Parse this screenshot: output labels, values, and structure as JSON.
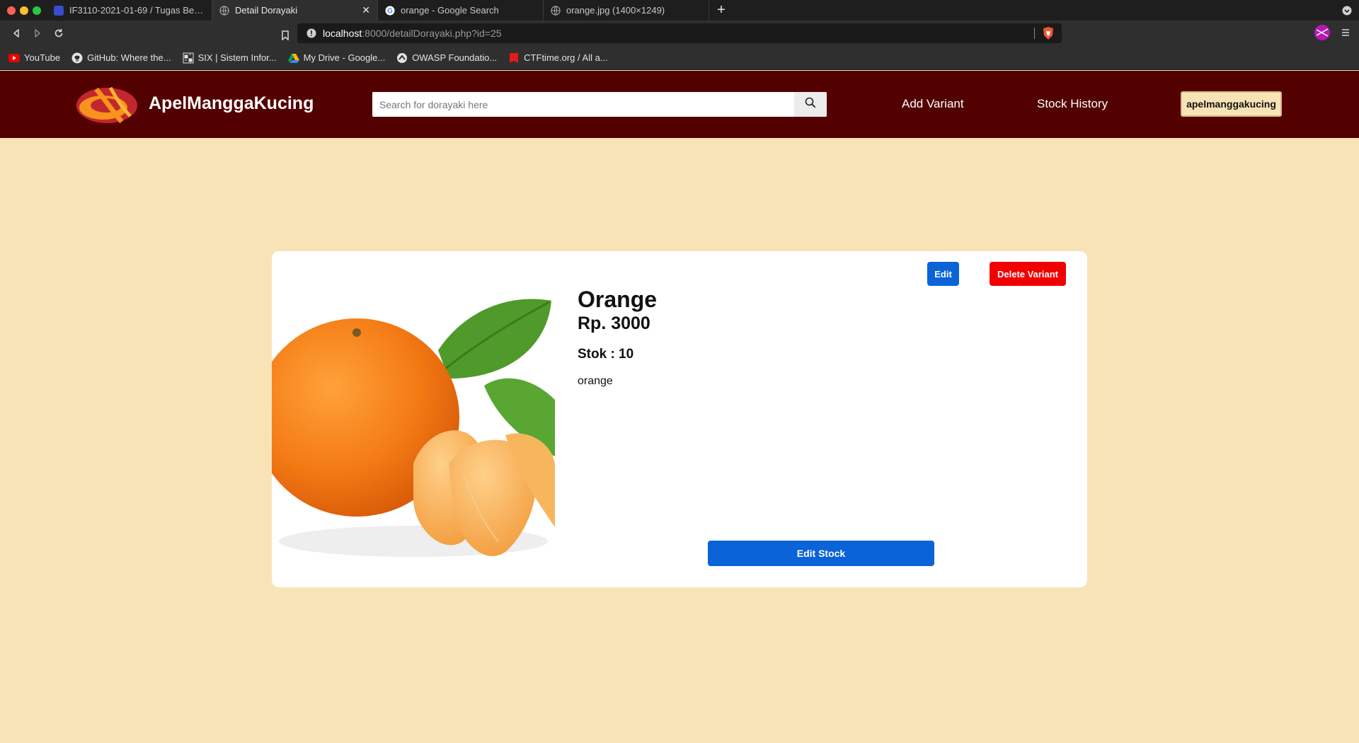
{
  "browser": {
    "tabs": [
      {
        "title": "IF3110-2021-01-69 / Tugas Besar 1",
        "icon": "gitlab-icon",
        "active": false
      },
      {
        "title": "Detail Dorayaki",
        "icon": "globe-icon",
        "active": true
      },
      {
        "title": "orange - Google Search",
        "icon": "google-icon",
        "active": false
      },
      {
        "title": "orange.jpg (1400×1249)",
        "icon": "globe-icon",
        "active": false
      }
    ],
    "url_host": "localhost",
    "url_rest": ":8000/detailDorayaki.php?id=25",
    "bookmarks": [
      {
        "label": "YouTube",
        "icon": "youtube-icon"
      },
      {
        "label": "GitHub: Where the...",
        "icon": "github-icon"
      },
      {
        "label": "SIX | Sistem Infor...",
        "icon": "six-icon"
      },
      {
        "label": "My Drive - Google...",
        "icon": "drive-icon"
      },
      {
        "label": "OWASP Foundatio...",
        "icon": "owasp-icon"
      },
      {
        "label": "CTFtime.org / All a...",
        "icon": "ctftime-icon"
      }
    ]
  },
  "header": {
    "brand": "ApelManggaKucing",
    "search_placeholder": "Search for dorayaki here",
    "nav_add": "Add Variant",
    "nav_history": "Stock History",
    "user": "apelmanggakucing"
  },
  "product": {
    "name": "Orange",
    "price": "Rp. 3000",
    "stock": "Stok : 10",
    "description": "orange",
    "edit_label": "Edit",
    "delete_label": "Delete Variant",
    "edit_stock_label": "Edit Stock"
  },
  "colors": {
    "header_bg": "#530000",
    "page_bg": "#f7e3b5",
    "primary": "#0b63d8",
    "danger": "#f00000"
  }
}
